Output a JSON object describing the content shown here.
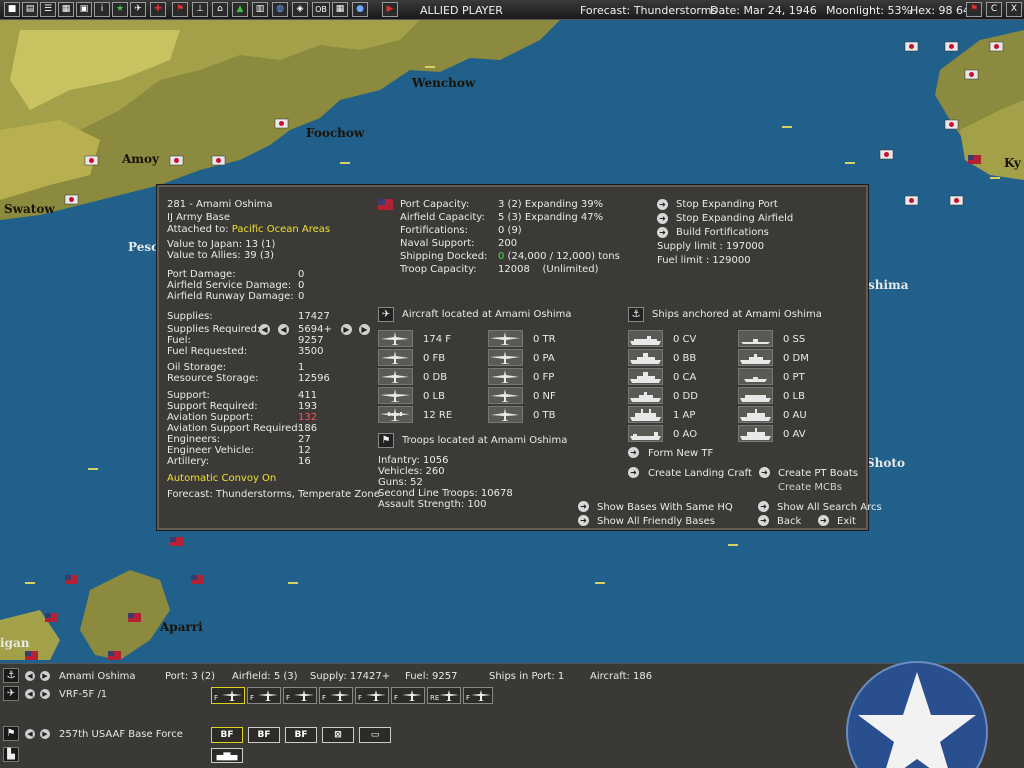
{
  "topbar": {
    "player": "ALLIED PLAYER",
    "forecast": "Forecast: Thunderstorms",
    "date": "Date: Mar 24, 1946",
    "moonlight": "Moonlight: 53%",
    "hex": "Hex: 98 64",
    "buttons": [
      "turn-icon",
      "doc-icon",
      "list-icon",
      "map-icon",
      "info-icon",
      "star-icon",
      "plane-icon",
      "ship-icon",
      "flag-icon",
      "sub-icon",
      "base-icon",
      "terrain-icon",
      "base-list-icon",
      "globe-icon",
      "shield-icon",
      "ob-icon",
      "report-icon",
      "chat-icon",
      "end-turn-icon"
    ],
    "ob_label": "OB",
    "right_c": "C",
    "right_x": "X"
  },
  "map_labels": {
    "wenchow": "Wenchow",
    "foochow": "Foochow",
    "amoy": "Amoy",
    "swatow": "Swatow",
    "pesc": "Pesc",
    "oshima": "shima",
    "shoto": "Shoto",
    "aparri": "Aparri",
    "igan": "igan",
    "ky": "Ky"
  },
  "panel": {
    "base_id": "281 - Amami Oshima",
    "base_type": "IJ Army Base",
    "attached_label": "Attached to:",
    "attached_value": "Pacific Ocean Areas",
    "value_japan": "Value to Japan: 13 (1)",
    "value_allies": "Value to Allies: 39 (3)",
    "damage": [
      {
        "label": "Port Damage:",
        "value": "0"
      },
      {
        "label": "Airfield Service Damage:",
        "value": "0"
      },
      {
        "label": "Airfield Runway Damage:",
        "value": "0"
      }
    ],
    "supplies_label": "Supplies:",
    "supplies_value": "17427",
    "supplies_req_label": "Supplies Required:",
    "supplies_req_value": "5694+",
    "fuel_label": "Fuel:",
    "fuel_value": "9257",
    "fuel_req_label": "Fuel Requested:",
    "fuel_req_value": "3500",
    "oil_label": "Oil Storage:",
    "oil_value": "1",
    "resource_label": "Resource Storage:",
    "resource_value": "12596",
    "support": [
      {
        "label": "Support:",
        "value": "411"
      },
      {
        "label": "Support Required:",
        "value": "193"
      },
      {
        "label": "Aviation Support:",
        "value": "132"
      },
      {
        "label": "Aviation Support Required:",
        "value": "186"
      },
      {
        "label": "Engineers:",
        "value": "27"
      },
      {
        "label": "Engineer Vehicle:",
        "value": "12"
      },
      {
        "label": "Artillery:",
        "value": "16"
      }
    ],
    "convoy": "Automatic Convoy On",
    "forecast": "Forecast: Thunderstorms, Temperate Zone",
    "capacity": [
      {
        "label": "Port Capacity:",
        "value": "3 (2) Expanding 39%"
      },
      {
        "label": "Airfield Capacity:",
        "value": "5 (3) Expanding 47%"
      },
      {
        "label": "Fortifications:",
        "value": "0 (9)"
      },
      {
        "label": "Naval Support:",
        "value": "200"
      },
      {
        "label": "Shipping Docked:",
        "value_green": "0",
        "value": " (24,000 / 12,000) tons"
      },
      {
        "label": "Troop Capacity:",
        "value": "12008    (Unlimited)"
      }
    ],
    "actions_right": {
      "stop_port": "Stop Expanding Port",
      "stop_airfield": "Stop Expanding Airfield",
      "build_fort": "Build Fortifications",
      "supply_limit": "Supply limit : 197000",
      "fuel_limit": "Fuel limit : 129000"
    },
    "aircraft_header": "Aircraft located at Amami Oshima",
    "aircraft_left": [
      {
        "value": "174 F"
      },
      {
        "value": "0 FB"
      },
      {
        "value": "0 DB"
      },
      {
        "value": "0 LB"
      },
      {
        "value": "12 RE"
      }
    ],
    "aircraft_right": [
      {
        "value": "0 TR"
      },
      {
        "value": "0 PA"
      },
      {
        "value": "0 FP"
      },
      {
        "value": "0 NF"
      },
      {
        "value": "0 TB"
      }
    ],
    "ships_header": "Ships anchored at Amami Oshima",
    "ships_left": [
      {
        "value": "0 CV"
      },
      {
        "value": "0 BB"
      },
      {
        "value": "0 CA"
      },
      {
        "value": "0 DD"
      },
      {
        "value": "1 AP"
      },
      {
        "value": "0 AO"
      }
    ],
    "ships_right": [
      {
        "value": "0 SS"
      },
      {
        "value": "0 DM"
      },
      {
        "value": "0 PT"
      },
      {
        "value": "0 LB"
      },
      {
        "value": "0 AU"
      },
      {
        "value": "0 AV"
      }
    ],
    "troops_header": "Troops located at Amami Oshima",
    "troops": [
      "Infantry: 1056",
      "Vehicles: 260",
      "Guns: 52",
      "Second Line Troops: 10678",
      "Assault Strength: 100"
    ],
    "form_tf": "Form New TF",
    "create_landing": "Create Landing Craft",
    "create_pt": "Create PT Boats",
    "create_mcb": "Create MCBs",
    "show_same_hq": "Show Bases With Same HQ",
    "show_friendly": "Show All Friendly Bases",
    "show_arcs": "Show All Search Arcs",
    "back": "Back",
    "exit": "Exit"
  },
  "bottom": {
    "base_name": "Amami Oshima",
    "port": "Port: 3 (2)",
    "airfield": "Airfield: 5 (3)",
    "supply": "Supply: 17427+",
    "fuel": "Fuel: 9257",
    "ships_in_port": "Ships in Port: 1",
    "aircraft": "Aircraft: 186",
    "air_unit": "VRF-5F /1",
    "air_slots": [
      "F",
      "F",
      "F",
      "F",
      "F",
      "F",
      "RE",
      "F"
    ],
    "ground_unit": "257th USAAF Base Force",
    "ground_slots": [
      "BF",
      "BF",
      "BF"
    ]
  }
}
